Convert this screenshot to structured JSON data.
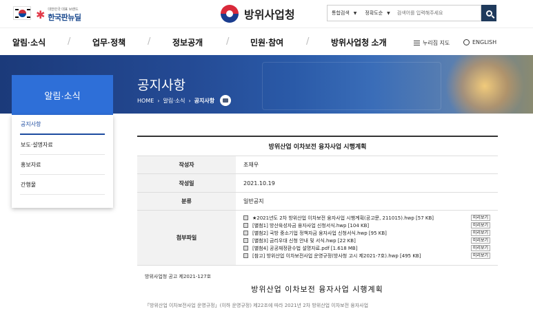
{
  "header": {
    "brand_small": "대한민국 대표 브랜드",
    "brand_big": "한국판뉴딜",
    "agency_name": "방위사업청",
    "search": {
      "scope": "통합검색",
      "sort": "정확도순",
      "placeholder": "검색어를 입력해주세요"
    }
  },
  "gnb": {
    "items": [
      "알림·소식",
      "업무·정책",
      "정보공개",
      "민원·참여",
      "방위사업청 소개"
    ],
    "sitemap": "누리집 지도",
    "english": "ENGLISH"
  },
  "banner": {
    "page_title": "공지사항",
    "breadcrumb": [
      "HOME",
      "알림·소식",
      "공지사항"
    ]
  },
  "sidebar": {
    "title": "알림·소식",
    "items": [
      "공지사항",
      "보도·설명자료",
      "홍보자료",
      "간행물"
    ]
  },
  "board": {
    "title": "방위산업 이차보전 융자사업 시행계획",
    "fields": {
      "author_label": "작성자",
      "author": "조재우",
      "date_label": "작성일",
      "date": "2021.10.19",
      "category_label": "분류",
      "category": "일반공지",
      "attach_label": "첨부파일"
    },
    "preview_label": "미리보기",
    "files": [
      "★2021년도 2차 방위산업 이차보전 융자사업 시행계획(공고문, 211015).hwp [57 KB]",
      "[별첨1] 방산육성자금 융자사업 신청서식.hwp [104 KB]",
      "[별첨2] 국방 중소기업 정책자금 융자사업 신청서식.hwp [95 KB]",
      "[별첨3] 금리우대 신청 안내 및 서식.hwp [22 KB]",
      "[별첨4] 공공재정환수법 설명자료.pdf [1.618 MB]",
      "[참고] 방위산업 이차보전사업 운영규정(방사청 고시 제2021-7호).hwp [495 KB]"
    ]
  },
  "content": {
    "notice_no": "방위사업청 공고 제2021-127호",
    "doc_title": "방위산업 이차보전 융자사업 시행계획",
    "doc_line": "「방위산업 이차보전사업 운영규정」(이하 운영규정) 제22조에 따라 2021년 2차 방위산업 이차보전 융자사업"
  }
}
